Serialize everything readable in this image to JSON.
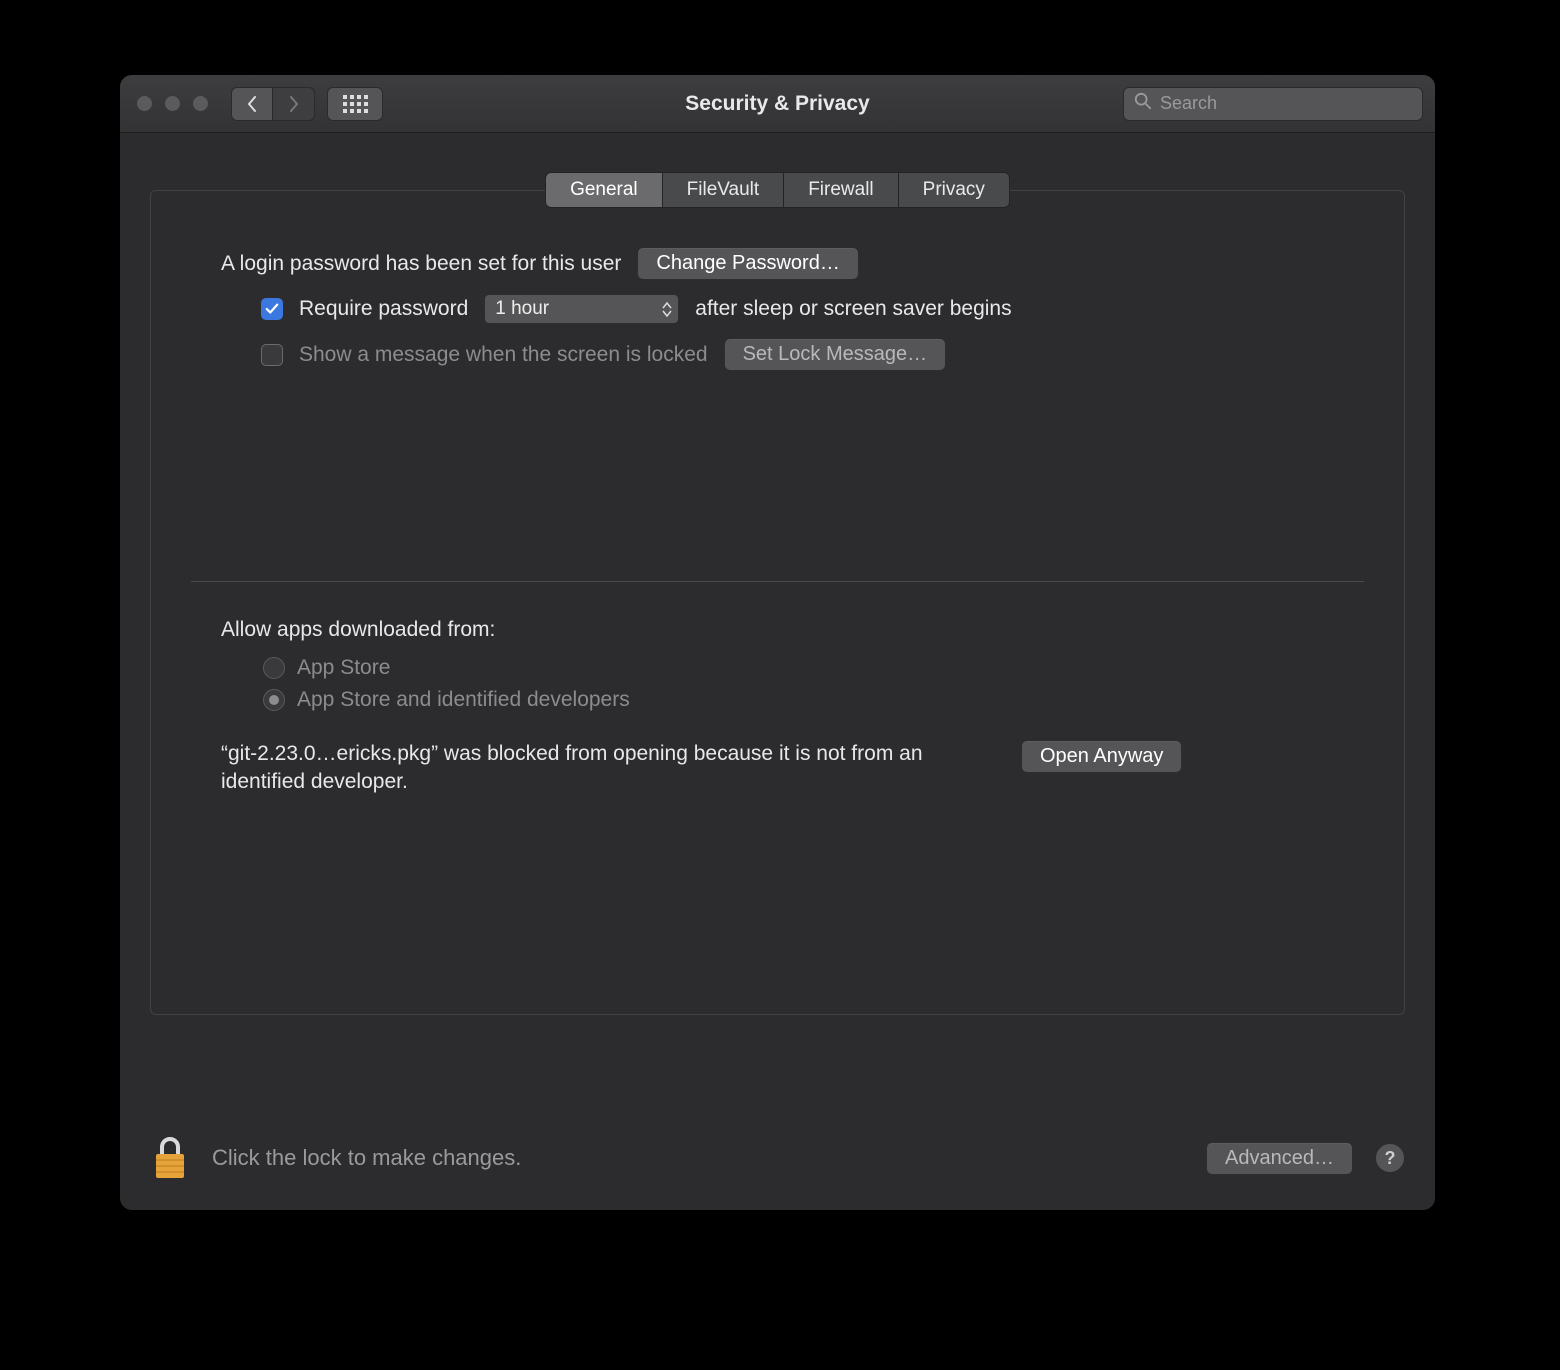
{
  "window": {
    "title": "Security & Privacy",
    "search_placeholder": "Search"
  },
  "tabs": [
    {
      "label": "General",
      "active": true
    },
    {
      "label": "FileVault",
      "active": false
    },
    {
      "label": "Firewall",
      "active": false
    },
    {
      "label": "Privacy",
      "active": false
    }
  ],
  "general": {
    "login_password_text": "A login password has been set for this user",
    "change_password_label": "Change Password…",
    "require_password": {
      "checked": true,
      "label_before": "Require password",
      "delay_selected": "1 hour",
      "label_after": "after sleep or screen saver begins"
    },
    "show_message": {
      "checked": false,
      "label": "Show a message when the screen is locked",
      "button_label": "Set Lock Message…"
    },
    "allow_apps_heading": "Allow apps downloaded from:",
    "allow_apps_options": [
      {
        "label": "App Store",
        "selected": false
      },
      {
        "label": "App Store and identified developers",
        "selected": true
      }
    ],
    "blocked": {
      "text": "“git-2.23.0…ericks.pkg” was blocked from opening because it is not from an identified developer.",
      "button_label": "Open Anyway"
    }
  },
  "footer": {
    "lock_text": "Click the lock to make changes.",
    "advanced_label": "Advanced…",
    "help_label": "?"
  }
}
